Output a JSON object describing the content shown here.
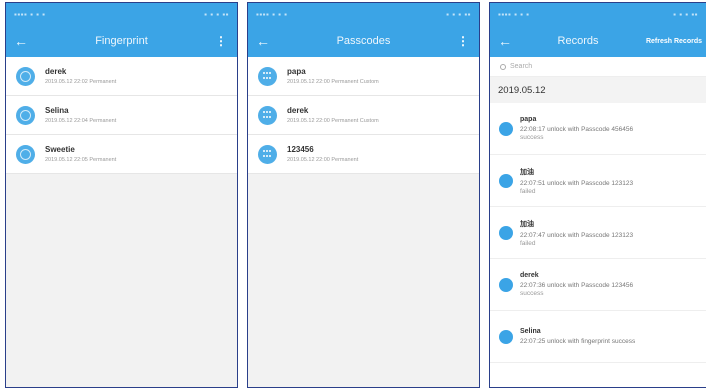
{
  "fingerprints_screen": {
    "title": "Fingerprint",
    "items": [
      {
        "name": "derek",
        "sub": "2019.05.12 22:02 Permanent"
      },
      {
        "name": "Selina",
        "sub": "2019.05.12 22:04 Permanent"
      },
      {
        "name": "Sweetie",
        "sub": "2019.05.12 22:05 Permanent"
      }
    ]
  },
  "passcodes_screen": {
    "title": "Passcodes",
    "items": [
      {
        "name": "papa",
        "sub": "2019.05.12 22:00 Permanent Custom"
      },
      {
        "name": "derek",
        "sub": "2019.05.12 22:00 Permanent Custom"
      },
      {
        "name": "123456",
        "sub": "2019.05.12 22:00 Permanent"
      }
    ]
  },
  "records_screen": {
    "title": "Records",
    "refresh_label": "Refresh Records",
    "search_placeholder": "Search",
    "date": "2019.05.12",
    "records": [
      {
        "name": "papa",
        "detail": "22:08:17 unlock with Passcode 456456",
        "result": "success"
      },
      {
        "name": "加油",
        "detail": "22:07:51 unlock with Passcode 123123",
        "result": "failed"
      },
      {
        "name": "加油",
        "detail": "22:07:47 unlock with Passcode 123123",
        "result": "failed"
      },
      {
        "name": "derek",
        "detail": "22:07:36 unlock with Passcode 123456",
        "result": "success"
      },
      {
        "name": "Selina",
        "detail": "22:07:25 unlock with fingerprint success",
        "result": ""
      }
    ]
  },
  "icons": {
    "back": "arrow-left-icon",
    "menu": "more-vertical-icon",
    "fingerprint": "fingerprint-icon",
    "passcode": "keypad-icon",
    "search": "search-icon"
  },
  "colors": {
    "accent": "#3ba4e6",
    "frame": "#2a3f8a"
  }
}
